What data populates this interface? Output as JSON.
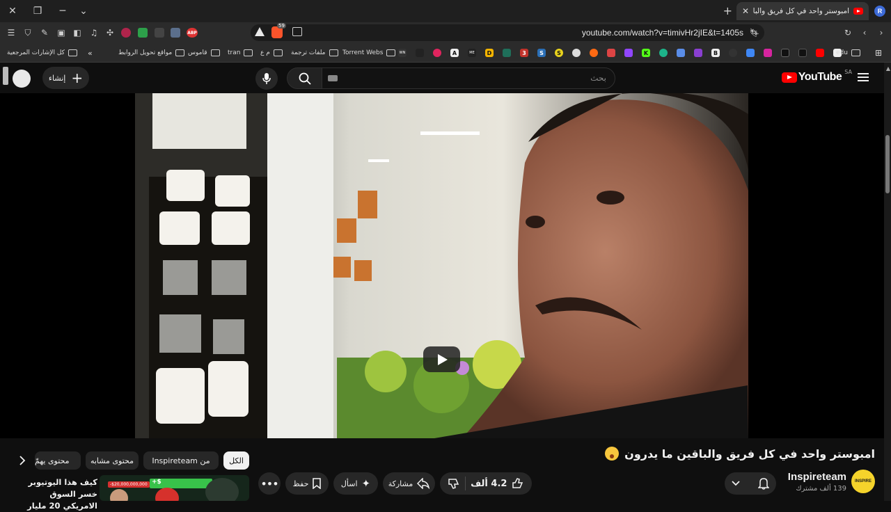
{
  "browser": {
    "tab_title": "امبوستر واحد في كل فريق والباقين ما يدرون",
    "profile_initial": "R",
    "url": "youtube.com/watch?v=timivHr2jIE&t=1405s",
    "ext_badge": "59",
    "abp_label": "ABP"
  },
  "bookmarks": {
    "all_bookmarks": "كل الإشارات المرجعية",
    "items": [
      {
        "label": "مواقع تحويل الروابط"
      },
      {
        "label": "قاموس"
      },
      {
        "label": "tran"
      },
      {
        "label": "م ع"
      },
      {
        "label": "ملفات ترجمة"
      },
      {
        "label": "Torrent Webs"
      }
    ],
    "edu_label": "edu",
    "icon_letters": [
      "WN",
      "A",
      "ME",
      "D",
      "3",
      "S",
      "S",
      "K",
      "B"
    ]
  },
  "youtube": {
    "search_placeholder": "بحث",
    "create_label": "إنشاء",
    "logo_text": "YouTube",
    "country_code": "SA"
  },
  "video": {
    "title": "امبوستر واحد في كل فريق والباقين ما يدرون",
    "likes": "4.2 ألف",
    "share_label": "مشاركة",
    "ask_label": "اسأل",
    "save_label": "حفظ"
  },
  "channel": {
    "name": "Inspireteam",
    "subscribers": "139 ألف مشترك",
    "avatar_text": "INSPIRE"
  },
  "chips": {
    "all": "الكل",
    "from_channel": "من Inspireteam",
    "similar": "محتوى مشابه",
    "related": "محتوى يهمّ"
  },
  "recommendation": {
    "title": "كيف هذا اليوتيوبر خسر السوق الامريكي 20 مليار",
    "thumb_text_1": "-$20,000,000,000",
    "thumb_text_2": "+$"
  }
}
